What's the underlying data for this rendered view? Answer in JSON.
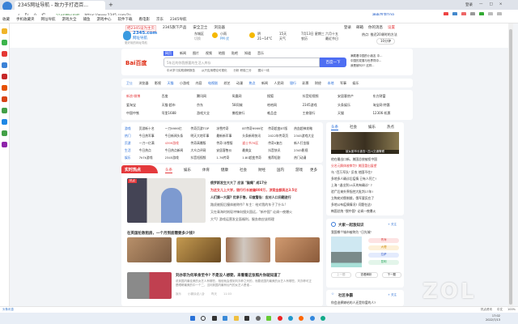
{
  "browser": {
    "tab_title": "2345网址导航 - 致力于打造百...",
    "url_site": "2345网址导航",
    "url": "https://www.2345.com/?n",
    "address_right": "神奇范游TOP",
    "window_controls": [
      "登录",
      "—",
      "□",
      "×"
    ]
  },
  "bookmarks": [
    "收藏",
    "手机收藏夹",
    "网址导航",
    "游戏大全",
    "捕鱼",
    "游戏中心",
    "软件下载",
    "看电影",
    "京东",
    "2345导航"
  ],
  "top_links": {
    "left": [
      "把2345设为主页",
      "2345旗下产品",
      "安全卫士",
      "浏览器"
    ],
    "right": [
      "登录",
      "邮箱",
      "你的消息",
      "设置"
    ]
  },
  "header": {
    "logo": "2345.com",
    "logo_sub": "网址导航",
    "slogan": "更好用的网址导航",
    "city": "东城区",
    "city_sub": "切换",
    "w1": "小雨",
    "w1b": "PM 优",
    "w2": "阴",
    "w2b": "21~14°C",
    "w3": "15天",
    "w3b": "天气",
    "date": "7月13日 星期三",
    "lunar": "六月十五",
    "lunar2": "农历",
    "holiday": "最近节日",
    "search_hint": "热点: 推迟20课时的方法",
    "hot_btn": "10分钟"
  },
  "baidu": {
    "tabs": [
      "网页",
      "新闻",
      "图片",
      "视频",
      "地图",
      "贴吧",
      "知道",
      "音乐"
    ],
    "logo": "Bai百度",
    "placeholder": "5年后的你我想要的生活入库存",
    "button": "百度一下",
    "hints": [
      "中大学习实践调研报告",
      "从只应用理论可视化",
      "分析 积极三分",
      "图片一线"
    ],
    "hot": [
      "满载着中国的小朋友 中...",
      "中国的发展与世界同中...",
      "我是被叫3?  这样..."
    ]
  },
  "nav": [
    "卫士",
    "浏览器",
    "影视",
    "天猫",
    "小游戏",
    "内容",
    "电视剧",
    "综艺",
    "动漫",
    "热点",
    "新闻",
    "人民网",
    "银行",
    "彩票",
    "财经",
    "本地",
    "军事",
    "娱乐"
  ],
  "links": [
    [
      "新浪·微博",
      "百度",
      "腾讯网",
      "凤凰网",
      "搜狐",
      "抖音短视频",
      "安居客房产",
      "东方财富"
    ],
    [
      "爱淘宝",
      "天猫·超市",
      "京东",
      "58同城",
      "哈哈网",
      "2345游戏",
      "头条娱乐",
      "淘宝网·特惠"
    ],
    [
      "中国中铁",
      "阿里1688",
      "游戏大全",
      "携程旅行",
      "唯品会",
      "工商银行",
      "天猫",
      "12306·机票"
    ]
  ],
  "categories": [
    {
      "name": "游戏",
      "items": [
        "页游新十名",
        "一刀9999亿",
        "传奇页游TOP",
        "冰雪传奇",
        "BT传奇9999亿",
        "传奇超变BT版",
        "热血超神攻略"
      ]
    },
    {
      "name": "热门",
      "items": [
        "今日热军事",
        "今日新闻头条",
        "明天大地军事",
        "最新新军事",
        "头条新闻快讯",
        "2022年传奇页",
        "2345游戏大全"
      ]
    },
    {
      "name": "页游",
      "items": [
        "一刀一亿满",
        "4399游戏",
        "传奇高爆版",
        "传奇·冰雪版",
        "道士书76区",
        "传奇0复古",
        "新人打金服"
      ]
    },
    {
      "name": "生活",
      "items": [
        "今日热点",
        "今日热点新闻",
        "大众点评网",
        "安居客售价",
        "最美女",
        "抖音快讯",
        "2345影视"
      ]
    },
    {
      "name": "娱乐",
      "items": [
        "7k7k游戏",
        "2345游戏",
        "抖音短视频",
        "1.76传奇",
        "1.80超变传奇",
        "推荐短剧",
        "热门动漫"
      ]
    }
  ],
  "hot": {
    "title": "实时热点",
    "tabs": [
      "头条",
      "娱乐",
      "体育",
      "健康",
      "社会",
      "财经",
      "国内",
      "游戏"
    ],
    "more": "更多",
    "badge": "热点",
    "items": [
      "俄罗斯发生大大了 应该 \"脑瘫\" 成17分",
      "为这女儿上大学，银行行长被骗800万，涉案金额高达3.5亿",
      "人们第一大国? 优承于售，印度警告：应对人口问题进行",
      "路虎被报后撞体被称作? 车主：给对我的车子了什么!",
      "又在青海时刻现冲锋向镜头国远，\"新中国\" 论调一夜爆火",
      "大气! 游戏运营发全面福利，服务商应该彻理"
    ],
    "rent_title": "在英国伦敦租房，一个月到底需要多少钱?",
    "article_title": "刘亦菲为何单身至今? 不是没人想娶，来看看这张照片你就知道了",
    "article_desc": "说到国内最佳美的女艺人有哪些，相信就会想到刘亦菲之列的，而要说国内最美的女艺人有哪些，刘亦菲可正是眼睛最美的中一个二，当问到国内最有仙气的女艺人是谁...",
    "article_meta": [
      "娱乐",
      "小糊涂说八卦",
      "昨天",
      "11:03"
    ]
  },
  "right": {
    "tabs": [
      "头条",
      "社会",
      "娱乐",
      "热点"
    ],
    "video_caption": "被女副市长被查! 四川交通警察",
    "news": [
      "他在最出口新，美国总统被拒中国",
      "分名元解体被审判? 美国重出展望",
      "乌 \"百万军队\" 反攻 他国不往?",
      "多地多人确诊后疫情 已有人死亡!",
      "上海 \"退出到14天的有确诊\" ?",
      "验尸后来外界指控大批判17年!",
      "立陶宛对俄制裁，俄军要反应了",
      "多地公布疫情情况? 问题在这!",
      "韩国总统 \"脱中国\" 论调一夜爆火"
    ],
    "quiz_title": "大家一起涨知识",
    "quiz_follow": "+ 关注",
    "quiz_q": "我国哪个城市被称为 \"日光城\"",
    "quiz_options": [
      "青海",
      "大理",
      "拉萨",
      "昆明"
    ],
    "quiz_btns": [
      "上一题",
      "查看解析",
      "下一题"
    ],
    "community_title": "社区争霸",
    "community_q": "你会选择嫁给的人还是你爱的人?"
  },
  "status": {
    "left": "头条讯息",
    "right": [
      "热点资讯",
      "中文",
      "100%"
    ]
  },
  "taskbar": {
    "time": "17:02",
    "date": "2022/7/13"
  },
  "watermark": "ZOL",
  "colors": {
    "accent": "#4e6ef2",
    "hot": "#e4393c",
    "link": "#1e66d6"
  }
}
